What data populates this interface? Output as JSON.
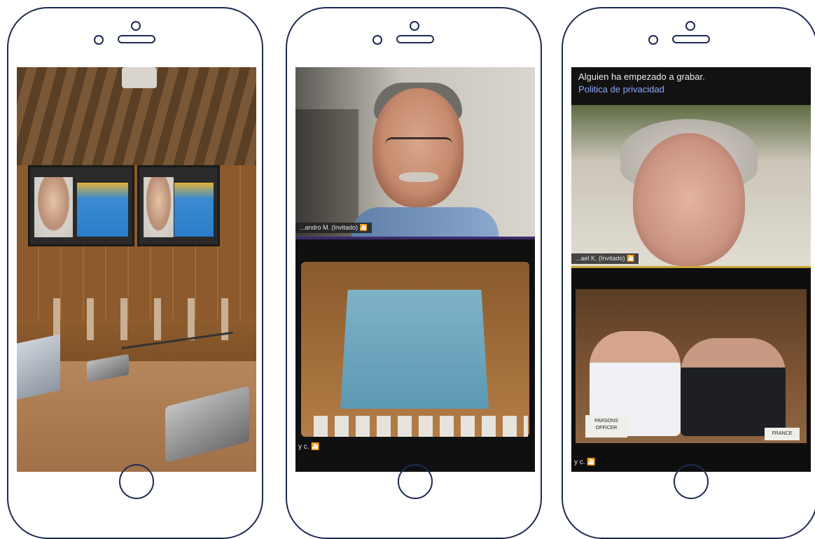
{
  "phone_2": {
    "speaker_name_tag": "...andro M. (Invitado) 🎦",
    "gallery_caption": "y c. 🎦"
  },
  "phone_3": {
    "recording_notice": "Alguien ha empezado a grabar.",
    "privacy_link": "Politica de privacidad",
    "speaker_name_tag": "...ael K. (Invitado) 🎦",
    "nameplate_left": "PARSONS OFFICER",
    "nameplate_right": "FRANCE",
    "gallery_caption": "y c. 🎦"
  },
  "colors": {
    "phone_outline": "#1d2a52",
    "privacy_link": "#8ea8ff"
  }
}
